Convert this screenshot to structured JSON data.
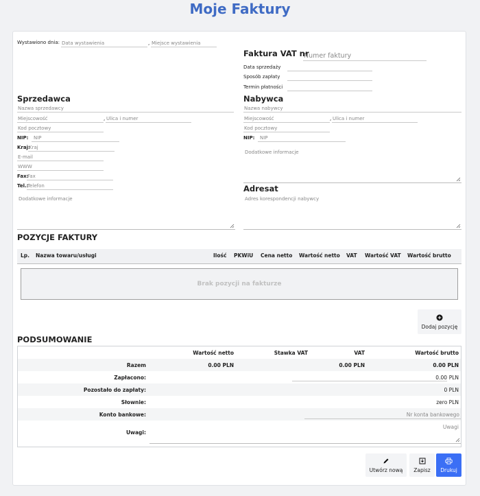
{
  "app": {
    "title": "Moje Faktury"
  },
  "issue": {
    "label": "Wystawiono dnia:",
    "date_placeholder": "Data wystawienia",
    "separator": ",",
    "place_placeholder": "Miejsce wystawienia"
  },
  "invoice": {
    "title": "Faktura VAT nr",
    "number_placeholder": "Numer faktury",
    "fields": [
      {
        "label": "Data sprzedaży"
      },
      {
        "label": "Sposób zapłaty"
      },
      {
        "label": "Termin płatności"
      }
    ]
  },
  "seller": {
    "heading": "Sprzedawca",
    "name_placeholder": "Nazwa sprzedawcy",
    "city_placeholder": "Miejscowość",
    "street_sep": ",",
    "street_placeholder": "Ulica i numer",
    "zip_placeholder": "Kod pocztowy",
    "nip_label": "NIP:",
    "nip_placeholder": "NIP",
    "country_label": "Kraj:",
    "country_placeholder": "Kraj",
    "email_placeholder": "E-mail",
    "www_placeholder": "WWW",
    "fax_label": "Fax:",
    "fax_placeholder": "Fax",
    "tel_label": "Tel.:",
    "tel_placeholder": "Telefon",
    "extra_placeholder": "Dodatkowe informacje"
  },
  "buyer": {
    "heading": "Nabywca",
    "name_placeholder": "Nazwa nabywcy",
    "city_placeholder": "Miejscowość",
    "street_sep": ",",
    "street_placeholder": "Ulica i numer",
    "zip_placeholder": "Kod pocztowy",
    "nip_label": "NIP:",
    "nip_placeholder": "NIP",
    "extra_placeholder": "Dodatkowe informacje"
  },
  "addressee": {
    "heading": "Adresat",
    "placeholder": "Adres korespondencji nabywcy"
  },
  "items": {
    "heading": "POZYCJE FAKTURY",
    "columns": [
      "Lp.",
      "Nazwa towaru/usługi",
      "Ilość",
      "PKWiU",
      "Cena netto",
      "Wartość netto",
      "VAT",
      "Wartość VAT",
      "Wartość brutto"
    ],
    "empty_text": "Brak pozycji na fakturze",
    "add_label": "Dodaj pozycję"
  },
  "summary": {
    "heading": "PODSUMOWANIE",
    "columns": [
      "Wartość netto",
      "Stawka VAT",
      "VAT",
      "Wartość brutto"
    ],
    "razem_label": "Razem",
    "razem_netto": "0.00 PLN",
    "razem_vat": "0.00 PLN",
    "razem_brutto": "0.00 PLN",
    "paid_label": "Zapłacono:",
    "paid_value": "0.00",
    "paid_currency": "PLN",
    "remaining_label": "Pozostało do zapłaty:",
    "remaining_value": "0 PLN",
    "words_label": "Słownie:",
    "words_value": "zero PLN",
    "bank_label": "Konto bankowe:",
    "bank_placeholder": "Nr konta bankowego",
    "notes_label": "Uwagi:",
    "notes_placeholder": "Uwagi"
  },
  "actions": {
    "new_label": "Utwórz nową",
    "save_label": "Zapisz",
    "print_label": "Drukuj"
  },
  "colors": {
    "title": "#3f6bc4",
    "primary": "#3b6ff5",
    "border": "#cfd2d6",
    "placeholder": "#888888"
  }
}
